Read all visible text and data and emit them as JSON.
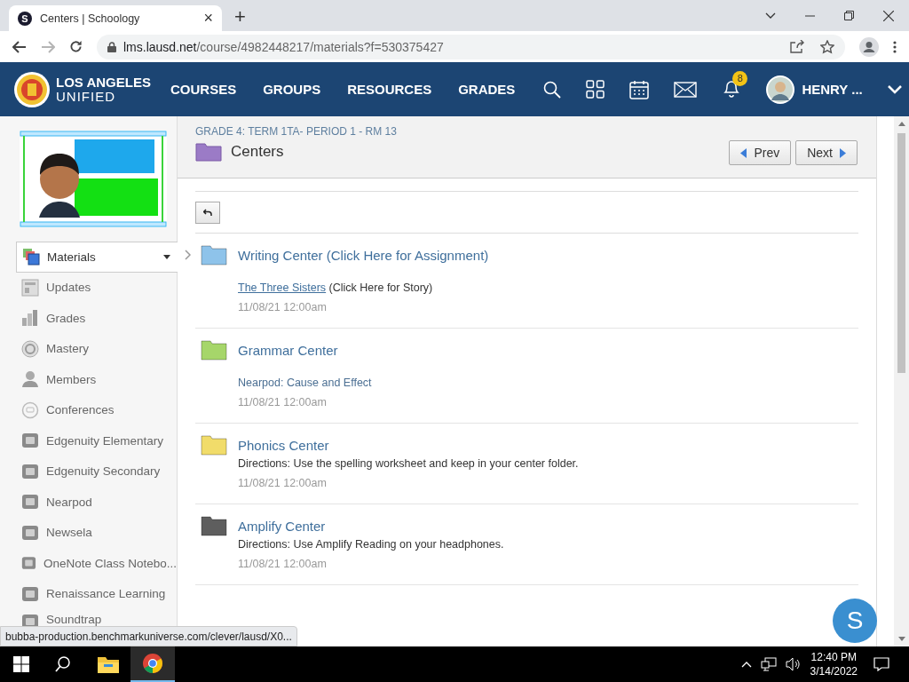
{
  "browser": {
    "tab": {
      "favicon_letter": "S",
      "title": "Centers | Schoology",
      "close": "×"
    },
    "new_tab": "+",
    "url": {
      "host": "lms.lausd.net",
      "path": "/course/4982448217/materials?f=530375427"
    },
    "forward_disabled": true
  },
  "header": {
    "logo": {
      "line1": "LOS ANGELES",
      "line2": "UNIFIED"
    },
    "nav": [
      {
        "label": "COURSES"
      },
      {
        "label": "GROUPS"
      },
      {
        "label": "RESOURCES"
      },
      {
        "label": "GRADES"
      }
    ],
    "notifications": "8",
    "user": "HENRY ..."
  },
  "sidebar": {
    "items": [
      {
        "label": "Materials",
        "kind": "materials",
        "selected": true
      },
      {
        "label": "Updates",
        "kind": "updates",
        "selected": false
      },
      {
        "label": "Grades",
        "kind": "grades",
        "selected": false
      },
      {
        "label": "Mastery",
        "kind": "mastery",
        "selected": false
      },
      {
        "label": "Members",
        "kind": "members",
        "selected": false
      },
      {
        "label": "Conferences",
        "kind": "conferences",
        "selected": false
      },
      {
        "label": "Edgenuity Elementary",
        "kind": "app",
        "selected": false
      },
      {
        "label": "Edgenuity Secondary",
        "kind": "app",
        "selected": false
      },
      {
        "label": "Nearpod",
        "kind": "app",
        "selected": false
      },
      {
        "label": "Newsela",
        "kind": "app",
        "selected": false
      },
      {
        "label": "OneNote Class Notebo...",
        "kind": "app",
        "selected": false
      },
      {
        "label": "Renaissance Learning",
        "kind": "app",
        "selected": false
      },
      {
        "label": "Soundtrap",
        "kind": "app",
        "selected": false
      }
    ]
  },
  "course": {
    "breadcrumb": "GRADE 4: TERM 1TA- PERIOD 1 - RM 13",
    "title": "Centers",
    "prev": "Prev",
    "next": "Next"
  },
  "materials": [
    {
      "title": "Writing Center (Click Here for Assignment)",
      "color": "#8ec3ea",
      "hovered": true,
      "description": [
        {
          "kind": "link",
          "text": "The Three Sisters"
        },
        {
          "kind": "text",
          "text": "(Click Here for Story)"
        }
      ],
      "date": "11/08/21 12:00am"
    },
    {
      "title": "Grammar Center",
      "color": "#a6d66a",
      "hovered": false,
      "description": [
        {
          "kind": "attachment",
          "text": "Nearpod: Cause and Effect"
        }
      ],
      "date": "11/08/21 12:00am"
    },
    {
      "title": "Phonics Center",
      "color": "#f1dc6a",
      "hovered": false,
      "description": [
        {
          "kind": "text",
          "text": "Directions: Use the spelling worksheet and keep in your center folder."
        }
      ],
      "date": "11/08/21 12:00am"
    },
    {
      "title": "Amplify Center",
      "color": "#5e5e5e",
      "hovered": false,
      "description": [
        {
          "kind": "text",
          "text": "Directions: Use Amplify Reading on your headphones."
        }
      ],
      "date": "11/08/21 12:00am"
    }
  ],
  "chat_button": "S",
  "status_url": "bubba-production.benchmarkuniverse.com/clever/lausd/X0...",
  "taskbar": {
    "apps": [
      {
        "kind": "explorer",
        "selected": false
      },
      {
        "kind": "chrome",
        "selected": true
      }
    ],
    "time": "12:40 PM",
    "date": "3/14/2022"
  }
}
